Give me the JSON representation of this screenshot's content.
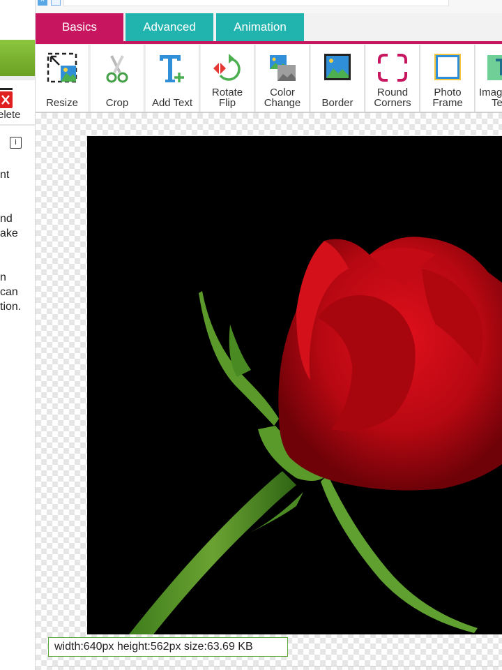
{
  "left_panel": {
    "delete_label": "elete",
    "help_lines": [
      "nt",
      "",
      "",
      "nd",
      "ake",
      "",
      "",
      "n",
      "can",
      "tion."
    ]
  },
  "top_bar": {
    "close_glyph": "×"
  },
  "tabs": [
    {
      "label": "Basics",
      "active": true
    },
    {
      "label": "Advanced",
      "active": false
    },
    {
      "label": "Animation",
      "active": false
    }
  ],
  "tools": [
    {
      "label1": "Resize",
      "label2": "",
      "icon": "resize-icon"
    },
    {
      "label1": "Crop",
      "label2": "",
      "icon": "scissors-icon"
    },
    {
      "label1": "Add Text",
      "label2": "",
      "icon": "add-text-icon"
    },
    {
      "label1": "Rotate",
      "label2": "Flip",
      "icon": "rotate-flip-icon"
    },
    {
      "label1": "Color",
      "label2": "Change",
      "icon": "color-change-icon"
    },
    {
      "label1": "Border",
      "label2": "",
      "icon": "border-icon"
    },
    {
      "label1": "Round",
      "label2": "Corners",
      "icon": "round-corners-icon"
    },
    {
      "label1": "Photo",
      "label2": "Frame",
      "icon": "photo-frame-icon"
    },
    {
      "label1": "Imag",
      "label2": "Te",
      "icon": "image-text-icon"
    }
  ],
  "image_info": {
    "text": "width:640px  height:562px  size:63.69 KB"
  },
  "colors": {
    "brand": "#c8155f",
    "tab_inactive": "#21b3ae",
    "accent_green": "#8cc63f",
    "icon_blue": "#2f8fd8"
  }
}
